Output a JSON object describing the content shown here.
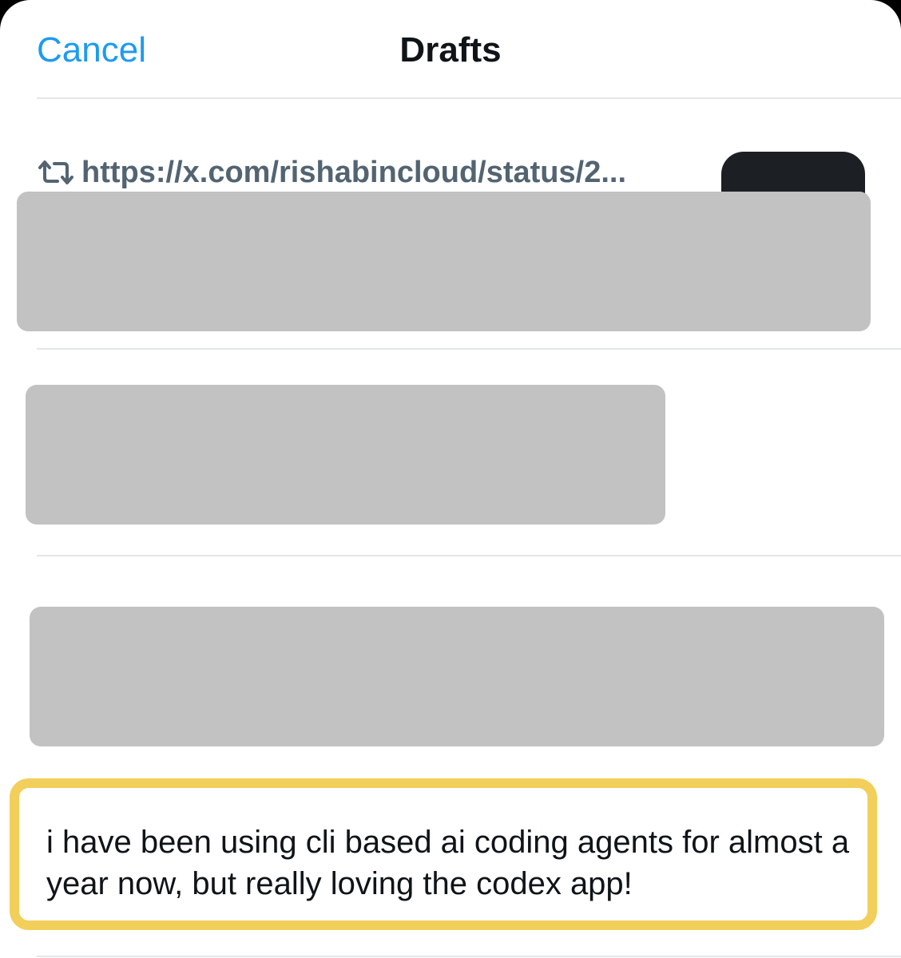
{
  "header": {
    "cancel_label": "Cancel",
    "title": "Drafts"
  },
  "drafts": [
    {
      "repost_url": "https://x.com/rishabincloud/status/2..."
    },
    {
      "text": "i have been using cli based ai coding agents for almost a year now, but really loving the codex app!"
    }
  ],
  "colors": {
    "accent": "#1d9bf0",
    "highlight": "#f2cf5b",
    "redaction": "#c2c2c2"
  },
  "icons": {
    "repost": "repost-icon"
  }
}
